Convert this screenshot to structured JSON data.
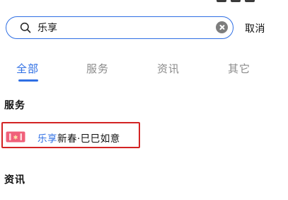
{
  "search": {
    "value": "乐享",
    "cancel_label": "取消"
  },
  "tabs": [
    {
      "label": "全部",
      "active": true
    },
    {
      "label": "服务",
      "active": false
    },
    {
      "label": "资讯",
      "active": false
    },
    {
      "label": "其它",
      "active": false
    }
  ],
  "sections": {
    "services_title": "服务",
    "news_title": "资讯"
  },
  "service_results": [
    {
      "highlight": "乐享",
      "rest": "新春·巳巳如意",
      "icon": "red-envelope-icon"
    }
  ],
  "colors": {
    "accent": "#2f6fe4",
    "selection_border": "#d32424",
    "icon_red": "#f0607a"
  }
}
